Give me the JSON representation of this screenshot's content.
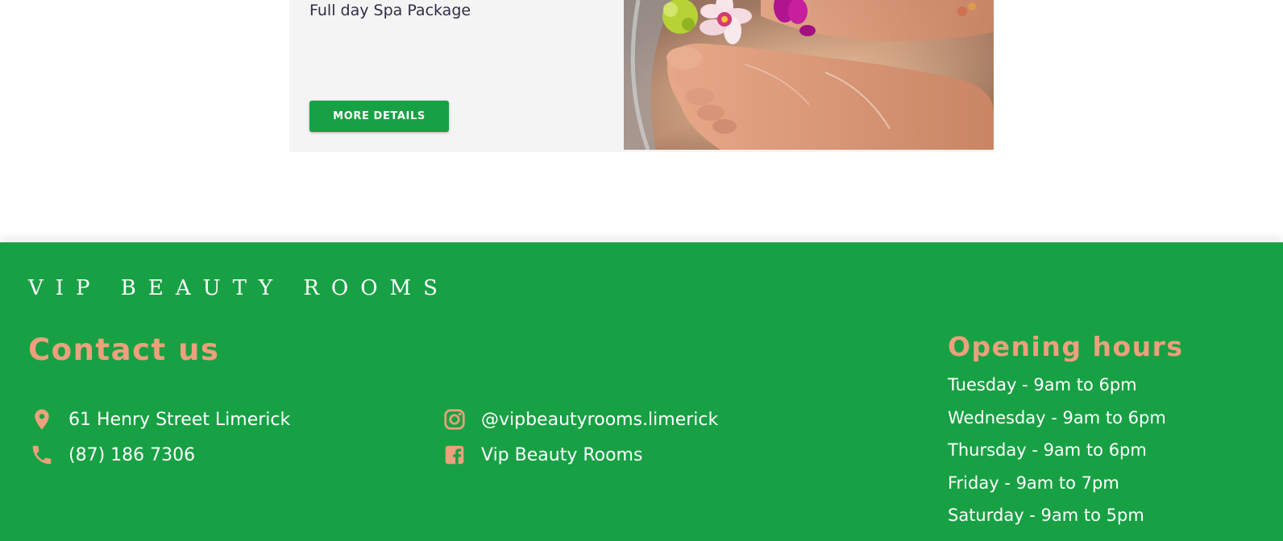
{
  "package": {
    "description": "Full day Spa Package",
    "button_label": "MORE DETAILS",
    "image_alt": "Spa pedicure foot soak with flowers"
  },
  "footer": {
    "brand": "VIP BEAUTY ROOMS",
    "contact": {
      "title": "Contact us",
      "address": "61 Henry Street Limerick",
      "phone": "(87) 186 7306",
      "instagram": "@vipbeautyrooms.limerick",
      "facebook": "Vip Beauty Rooms"
    },
    "hours": {
      "title": "Opening hours",
      "items": [
        "Tuesday - 9am to 6pm",
        "Wednesday - 9am to 6pm",
        "Thursday - 9am to 6pm",
        "Friday - 9am to 7pm",
        "Saturday - 9am to 5pm"
      ]
    }
  },
  "colors": {
    "brand_green": "#17a144",
    "accent_peach": "#eea07c",
    "card_background": "#f4f4f4",
    "text_dark": "#2f2d46"
  },
  "icons": {
    "address": "map-pin-icon",
    "phone": "phone-icon",
    "instagram": "instagram-icon",
    "facebook": "facebook-icon"
  }
}
